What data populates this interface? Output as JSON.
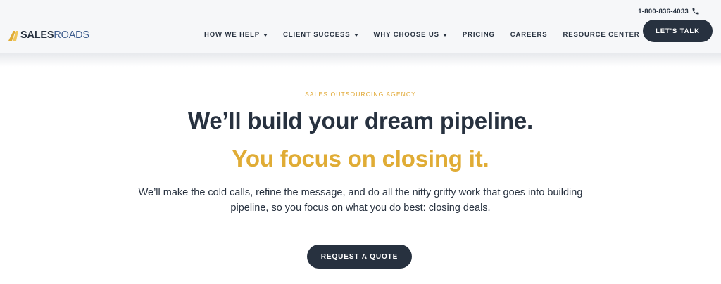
{
  "header": {
    "logo": {
      "part1": "SALES",
      "part2": "ROADS"
    },
    "phone": "1-800-836-4033",
    "nav": [
      {
        "label": "HOW WE HELP",
        "has_dropdown": true
      },
      {
        "label": "CLIENT SUCCESS",
        "has_dropdown": true
      },
      {
        "label": "WHY CHOOSE US",
        "has_dropdown": true
      },
      {
        "label": "PRICING",
        "has_dropdown": false
      },
      {
        "label": "CAREERS",
        "has_dropdown": false
      },
      {
        "label": "RESOURCE CENTER",
        "has_dropdown": true
      }
    ],
    "cta_label": "LET'S TALK"
  },
  "hero": {
    "eyebrow": "SALES OUTSOURCING AGENCY",
    "headline": "We’ll build your dream pipeline.",
    "subheadline": "You focus on closing it.",
    "body": "We’ll make the cold calls, refine the message, and do all the nitty gritty work that goes into building pipeline, so you focus on what you do best: closing deals.",
    "cta_label": "REQUEST A QUOTE"
  },
  "colors": {
    "navy": "#27313f",
    "gold": "#e0ac35",
    "header_bg": "#f6f7f9"
  },
  "icons": {
    "phone": "phone-icon",
    "logo_mark": "logo-mark-icon",
    "dropdown": "caret-down-icon"
  }
}
